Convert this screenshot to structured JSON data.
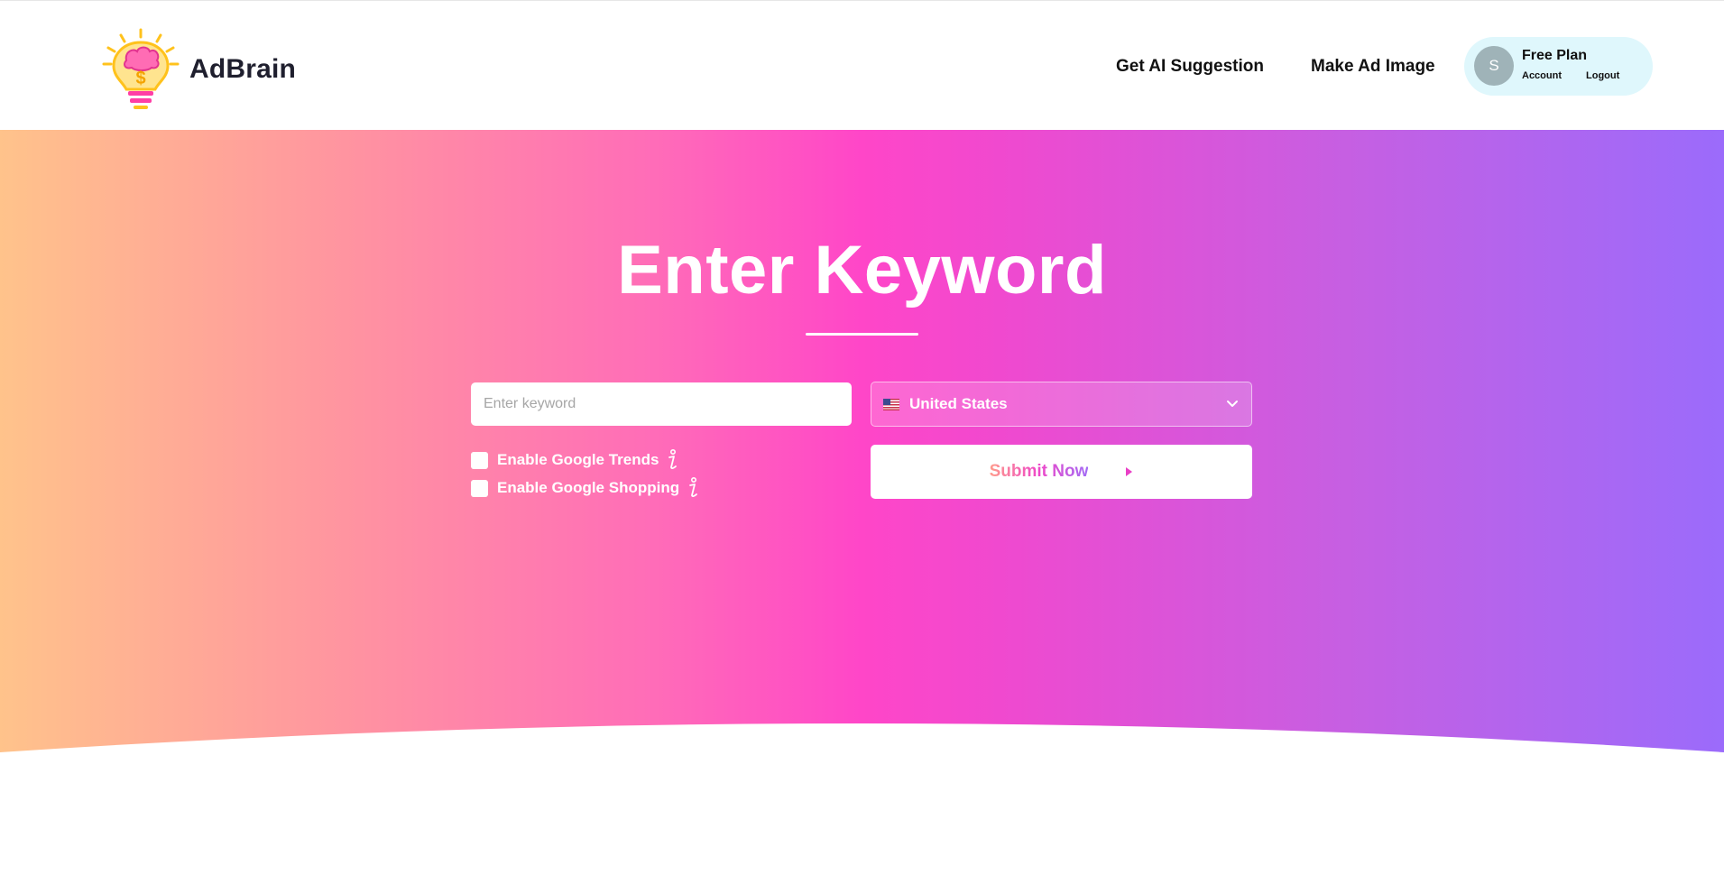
{
  "brand": {
    "name": "AdBrain"
  },
  "nav": {
    "ai_suggestion": "Get AI Suggestion",
    "ad_image": "Make Ad Image"
  },
  "account": {
    "avatar_initial": "S",
    "plan": "Free Plan",
    "account_link": "Account",
    "logout_link": "Logout"
  },
  "hero": {
    "title": "Enter Keyword"
  },
  "form": {
    "keyword_placeholder": "Enter keyword",
    "keyword_value": "",
    "country": "United States",
    "options": {
      "google_trends": "Enable Google Trends",
      "google_shopping": "Enable Google Shopping"
    },
    "submit_label": "Submit Now"
  },
  "colors": {
    "gradient_start": "#ffc38b",
    "gradient_mid": "#ff46c8",
    "gradient_end": "#9b6bfb",
    "account_bg": "#dff7fc"
  },
  "icons": {
    "logo": "lightbulb-brain-dollar-icon",
    "info": "info-icon",
    "chevron": "chevron-down-icon",
    "arrow": "arrow-right-icon",
    "flag": "us-flag-icon"
  }
}
